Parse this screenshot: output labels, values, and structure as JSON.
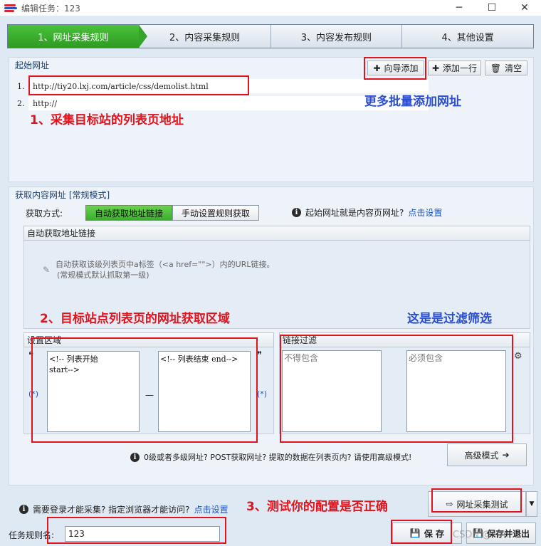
{
  "window": {
    "title": "编辑任务：123",
    "minimize": "─",
    "maximize": "☐",
    "close": "✕"
  },
  "steps": [
    {
      "label": "1、网址采集规则"
    },
    {
      "label": "2、内容采集规则"
    },
    {
      "label": "3、内容发布规则"
    },
    {
      "label": "4、其他设置"
    }
  ],
  "start_urls": {
    "title": "起始网址",
    "wizard_add": "向导添加",
    "add_row": "添加一行",
    "clear": "清空",
    "rows": [
      {
        "num": "1.",
        "value": "http://tiy20.lxj.com/article/css/demolist.html"
      },
      {
        "num": "2.",
        "value": "http://"
      }
    ]
  },
  "annotations": {
    "a1": "1、采集目标站的列表页地址",
    "a_more": "更多批量添加网址",
    "a2": "2、目标站点列表页的网址获取区域",
    "a_filter": "这是是过滤筛选",
    "a3": "3、测试你的配置是否正确"
  },
  "content_urls": {
    "title": "获取内容网址 [常规模式]",
    "method_label": "获取方式:",
    "method_auto": "自动获取地址链接",
    "method_manual": "手动设置规则获取",
    "start_is_content_q": "起始网址就是内容页网址?",
    "set_link": "点击设置",
    "auto_header": "自动获取地址链接",
    "auto_desc_line1": "自动获取该级列表页中a标签（<a href=\"\">）内的URL链接。",
    "auto_desc_line2": "(常规模式默认抓取第一级)",
    "area_header": "设置区域",
    "start_marker": "<!-- 列表开始\nstart-->",
    "end_marker": "<!-- 列表结束 end-->",
    "quote_open": "❝",
    "quote_close": "❞",
    "wildcard_left": "(*)",
    "wildcard_right": "(*)",
    "dash": "—",
    "filter_header": "链接过滤",
    "exclude_placeholder": "不得包含",
    "include_placeholder": "必须包含",
    "advanced_hint": "0级或者多级网址? POST获取网址? 提取的数据在列表页内? 请使用高级模式!",
    "advanced_button": "高级模式"
  },
  "bottom": {
    "login_hint": "需要登录才能采集? 指定浏览器才能访问?",
    "login_link": "点击设置",
    "test_button": "网址采集测试",
    "task_name_label": "任务规则名:",
    "task_name_value": "123",
    "save_button": "保 存",
    "save_exit_button": "保存并退出",
    "watermark": "CSDN @kfm..."
  },
  "colors": {
    "active_step": "#3aad2d",
    "annotation_red": "#e0141e",
    "annotation_blue": "#2a4ecf",
    "link": "#1656c2"
  }
}
